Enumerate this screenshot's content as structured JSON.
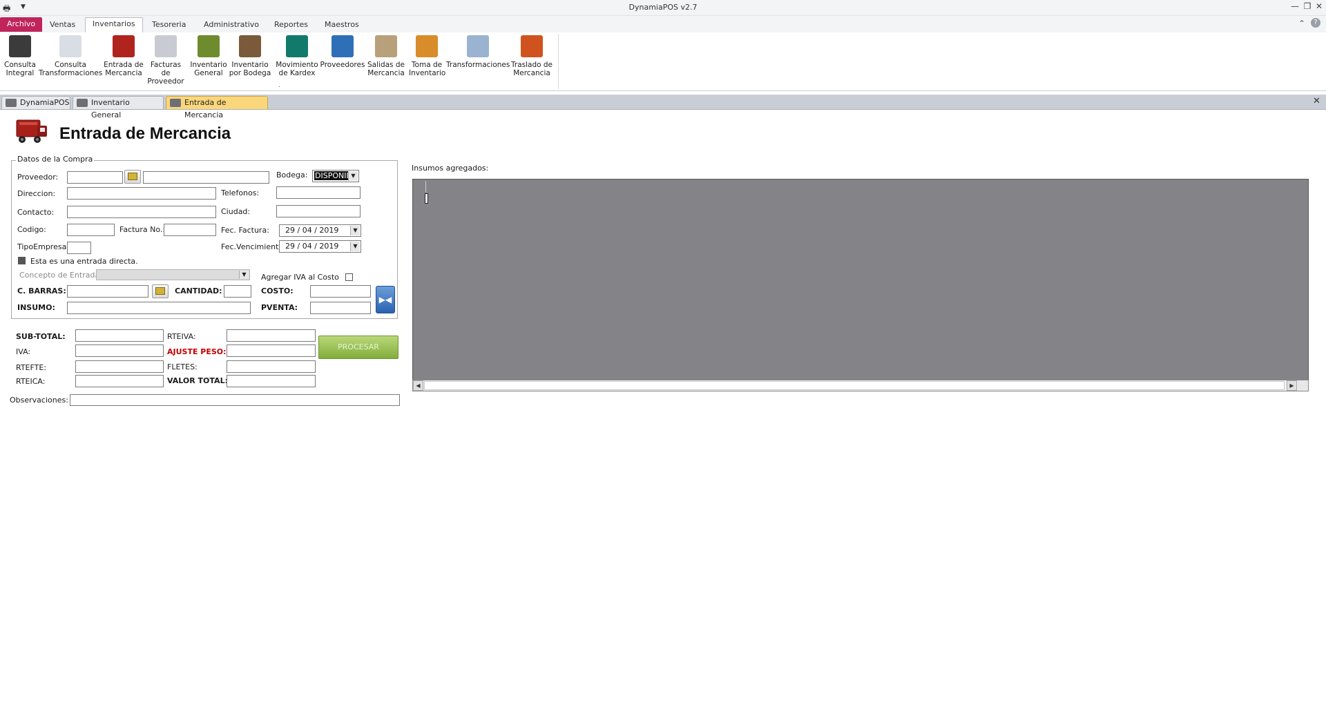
{
  "window": {
    "title": "DynamiaPOS v2.7"
  },
  "ribbon_tabs": [
    "Archivo",
    "Ventas",
    "Inventarios",
    "Tesoreria",
    "Administrativo",
    "Reportes",
    "Maestros"
  ],
  "ribbon_buttons": [
    {
      "line1": "Consulta",
      "line2": "Integral",
      "icon": "glasses-icon",
      "color": "#3b3b3b"
    },
    {
      "line1": "Consulta",
      "line2": "Transformaciones",
      "icon": "document-icon",
      "color": "#d9dde4"
    },
    {
      "line1": "Entrada de",
      "line2": "Mercancia",
      "icon": "truck-icon",
      "color": "#b0241e"
    },
    {
      "line1": "Facturas de",
      "line2": "Proveedor",
      "icon": "invoice-icon",
      "color": "#c8ccd2"
    },
    {
      "line1": "Inventario",
      "line2": "General",
      "icon": "boxes-icon",
      "color": "#6e8b2e"
    },
    {
      "line1": "Inventario",
      "line2": "por Bodega",
      "icon": "warehouse-icon",
      "color": "#7a5a3a"
    },
    {
      "line1": "Movimiento",
      "line2": "de Kardex",
      "icon": "book-icon",
      "color": "#127a6a"
    },
    {
      "line1": "Proveedores",
      "line2": "",
      "icon": "person-icon",
      "color": "#2f6fb8"
    },
    {
      "line1": "Salidas de",
      "line2": "Mercancia",
      "icon": "cart-icon",
      "color": "#b8a07a"
    },
    {
      "line1": "Toma de",
      "line2": "Inventario",
      "icon": "clipboard-icon",
      "color": "#d98c2a"
    },
    {
      "line1": "Transformaciones",
      "line2": "",
      "icon": "flask-icon",
      "color": "#9ab3d0"
    },
    {
      "line1": "Traslado de",
      "line2": "Mercancia",
      "icon": "forklift-icon",
      "color": "#d0531f"
    }
  ],
  "doc_tabs": [
    "DynamiaPOS",
    "Inventario General",
    "Entrada de Mercancia"
  ],
  "page_title": "Entrada de Mercancia",
  "group_title": "Datos de la Compra",
  "labels": {
    "proveedor": "Proveedor:",
    "bodega": "Bodega:",
    "direccion": "Direccion:",
    "telefonos": "Telefonos:",
    "contacto": "Contacto:",
    "ciudad": "Ciudad:",
    "codigo": "Codigo:",
    "factura_no": "Factura No.:",
    "fec_factura": "Fec. Factura:",
    "tipo_empresa": "TipoEmpresa:",
    "fec_vencimiento": "Fec.Vencimiento:",
    "entrada_directa": "Esta es una entrada directa.",
    "concepto_entrada": "Concepto de Entrada:",
    "agregar_iva": "Agregar IVA al Costo",
    "c_barras": "C. BARRAS:",
    "cantidad": "CANTIDAD:",
    "costo": "COSTO:",
    "insumo": "INSUMO:",
    "pventa": "PVENTA:",
    "sub_total": "SUB-TOTAL:",
    "rteiva": "RTEIVA:",
    "iva": "IVA:",
    "ajuste_peso": "AJUSTE PESO:",
    "rtefte": "RTEFTE:",
    "fletes": "FLETES:",
    "rteica": "RTEICA:",
    "valor_total": "VALOR TOTAL:",
    "observaciones": "Observaciones:",
    "insumos_agregados": "Insumos agregados:"
  },
  "values": {
    "bodega": "DISPONIB",
    "fec_factura": "29 / 04 / 2019",
    "fec_vencimiento": "29 / 04 / 2019",
    "entrada_directa_checked": true,
    "agregar_iva_checked": false
  },
  "buttons": {
    "procesar": "PROCESAR"
  }
}
